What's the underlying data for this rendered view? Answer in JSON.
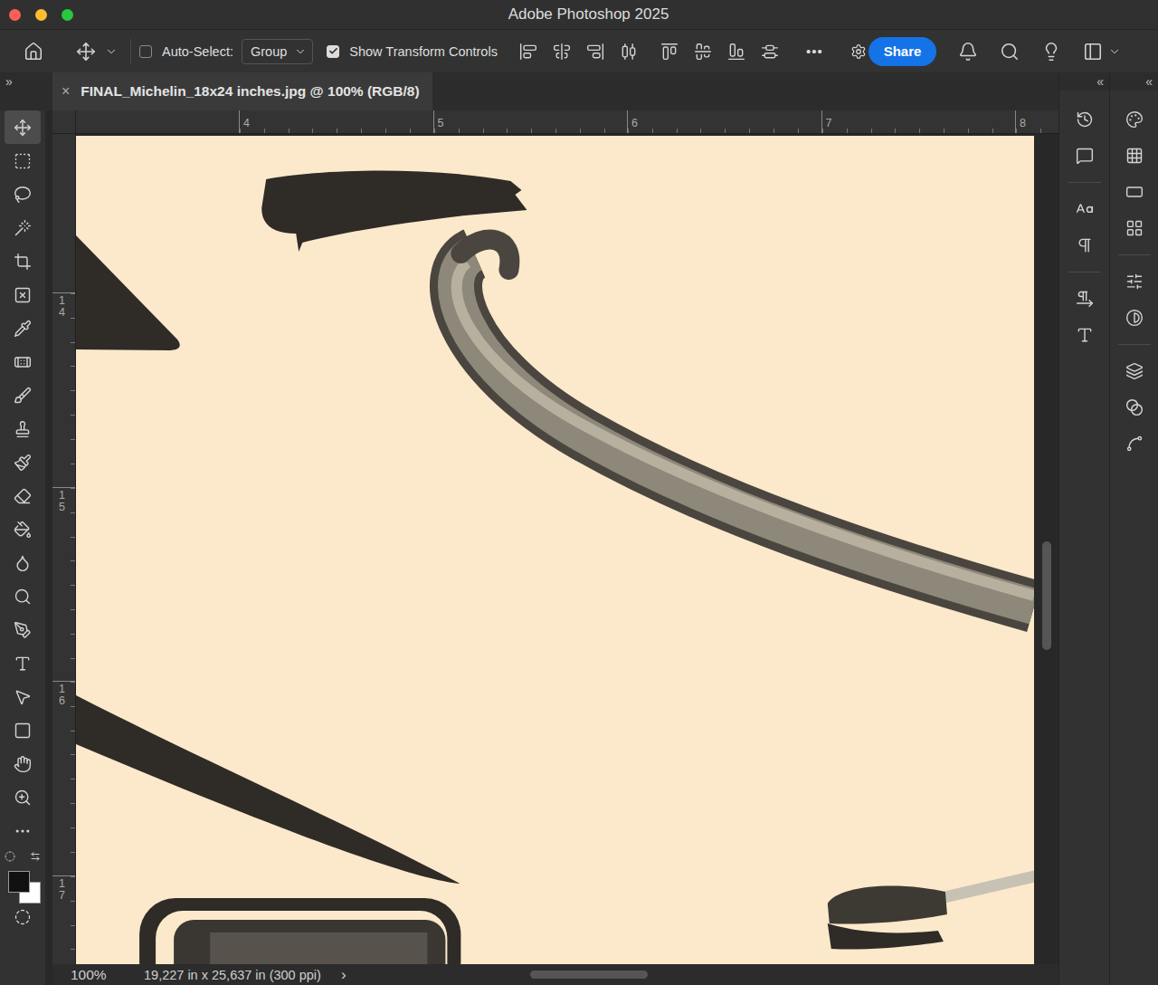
{
  "window": {
    "title": "Adobe Photoshop 2025"
  },
  "options_bar": {
    "auto_select": {
      "label": "Auto-Select:",
      "checked": false,
      "value": "Group"
    },
    "transform_controls": {
      "label": "Show Transform Controls",
      "checked": true
    },
    "more": "•••",
    "share": "Share"
  },
  "panel_toggles": {
    "left": "»",
    "right": [
      "«",
      "«"
    ]
  },
  "document_tab": {
    "title": "FINAL_Michelin_18x24 inches.jpg @ 100% (RGB/8)",
    "close": "×",
    "selected": true
  },
  "rulers": {
    "horizontal": [
      "4",
      "5",
      "6",
      "7",
      "8"
    ],
    "vertical": [
      "14",
      "15",
      "16",
      "17"
    ]
  },
  "tools": [
    {
      "kind": "move",
      "selected": true
    },
    {
      "kind": "marquee",
      "selected": false
    },
    {
      "kind": "lasso",
      "selected": false
    },
    {
      "kind": "wand",
      "selected": false
    },
    {
      "kind": "crop",
      "selected": false
    },
    {
      "kind": "frame",
      "selected": false
    },
    {
      "kind": "eyedropper",
      "selected": false
    },
    {
      "kind": "healing",
      "selected": false
    },
    {
      "kind": "brush",
      "selected": false
    },
    {
      "kind": "stamp",
      "selected": false
    },
    {
      "kind": "history",
      "selected": false
    },
    {
      "kind": "eraser",
      "selected": false
    },
    {
      "kind": "bucket",
      "selected": false
    },
    {
      "kind": "blur",
      "selected": false
    },
    {
      "kind": "dodge",
      "selected": false
    },
    {
      "kind": "pen",
      "selected": false
    },
    {
      "kind": "type",
      "selected": false
    },
    {
      "kind": "select",
      "selected": false
    },
    {
      "kind": "shape",
      "selected": false
    },
    {
      "kind": "hand",
      "selected": false
    },
    {
      "kind": "zoom",
      "selected": false
    },
    {
      "kind": "more",
      "selected": false
    }
  ],
  "colors": {
    "foreground": "#111111",
    "background": "#ffffff"
  },
  "status_bar": {
    "zoom": "100%",
    "info": "19,227 in x 25,637 in (300 ppi)",
    "arrow": "›"
  }
}
